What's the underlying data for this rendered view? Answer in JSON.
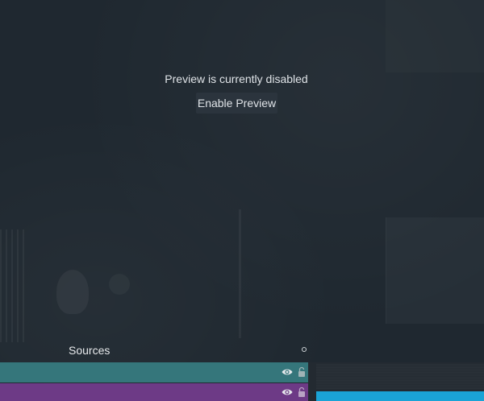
{
  "preview": {
    "message": "Preview is currently disabled",
    "enable_button_label": "Enable Preview"
  },
  "sources": {
    "title": "Sources",
    "rows": [
      {
        "color": "#35767b",
        "visible_icon": "eye-icon",
        "lock_icon": "unlock-icon"
      },
      {
        "color": "#6d3a86",
        "visible_icon": "eye-icon",
        "lock_icon": "unlock-icon"
      }
    ]
  },
  "colors": {
    "background": "#1f2830",
    "accent_blue": "#1aa3d6",
    "row_teal": "#35767b",
    "row_purple": "#6d3a86"
  }
}
